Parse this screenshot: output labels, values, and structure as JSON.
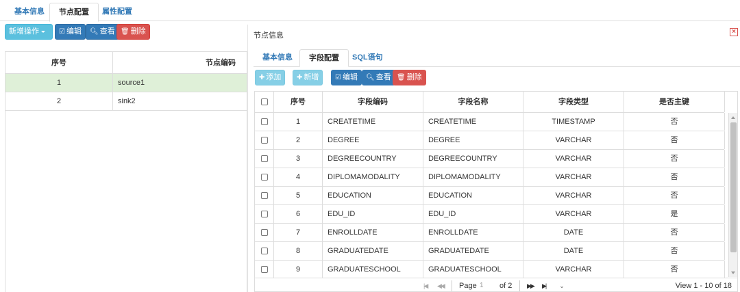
{
  "top_tabs": [
    "基本信息",
    "节点配置",
    "属性配置"
  ],
  "toolbar": {
    "new_op": "新增操作",
    "edit": "编辑",
    "view": "查看",
    "delete": "删除"
  },
  "left_grid": {
    "headers": [
      "序号",
      "节点编码"
    ],
    "rows": [
      {
        "no": "1",
        "code": "source1"
      },
      {
        "no": "2",
        "code": "sink2"
      }
    ]
  },
  "dialog": {
    "title": "节点信息",
    "close_symbol": "×",
    "tabs": [
      "基本信息",
      "字段配置",
      "SQL语句"
    ],
    "toolbar": {
      "add": "添加",
      "new": "新增",
      "edit": "编辑",
      "view": "查看",
      "delete": "删除"
    },
    "grid": {
      "headers": [
        "序号",
        "字段编码",
        "字段名称",
        "字段类型",
        "是否主键"
      ],
      "rows": [
        {
          "no": "1",
          "code": "CREATETIME",
          "name": "CREATETIME",
          "type": "TIMESTAMP",
          "pk": "否"
        },
        {
          "no": "2",
          "code": "DEGREE",
          "name": "DEGREE",
          "type": "VARCHAR",
          "pk": "否"
        },
        {
          "no": "3",
          "code": "DEGREECOUNTRY",
          "name": "DEGREECOUNTRY",
          "type": "VARCHAR",
          "pk": "否"
        },
        {
          "no": "4",
          "code": "DIPLOMAMODALITY",
          "name": "DIPLOMAMODALITY",
          "type": "VARCHAR",
          "pk": "否"
        },
        {
          "no": "5",
          "code": "EDUCATION",
          "name": "EDUCATION",
          "type": "VARCHAR",
          "pk": "否"
        },
        {
          "no": "6",
          "code": "EDU_ID",
          "name": "EDU_ID",
          "type": "VARCHAR",
          "pk": "是"
        },
        {
          "no": "7",
          "code": "ENROLLDATE",
          "name": "ENROLLDATE",
          "type": "DATE",
          "pk": "否"
        },
        {
          "no": "8",
          "code": "GRADUATEDATE",
          "name": "GRADUATEDATE",
          "type": "DATE",
          "pk": "否"
        },
        {
          "no": "9",
          "code": "GRADUATESCHOOL",
          "name": "GRADUATESCHOOL",
          "type": "VARCHAR",
          "pk": "否"
        }
      ]
    },
    "pager": {
      "page_label": "Page",
      "page_value": "1",
      "of_label": "of 2",
      "view_text": "View 1 - 10 of 18"
    }
  }
}
